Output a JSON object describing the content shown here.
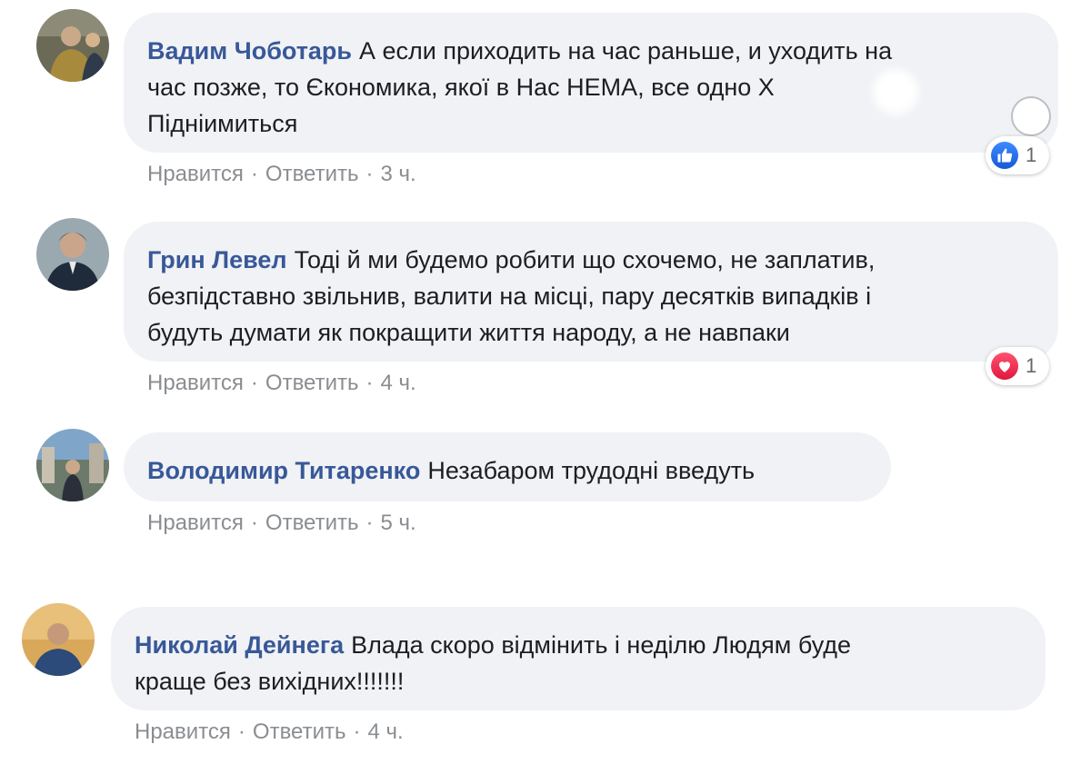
{
  "colors": {
    "bubble_bg": "#f0f2f5",
    "author": "#385898",
    "meta": "#8a8d91",
    "like_blue": "#1877f2",
    "love_red": "#e1173e"
  },
  "comments": [
    {
      "author": "Вадим Чоботарь",
      "text_lines": [
        "А если приходить на час раньше, и уходить на",
        "час позже, то Єкономика, якої в Нас НЕМА, все одно Х",
        "Підніимиться"
      ],
      "like": "Нравится",
      "reply": "Ответить",
      "time": "3 ч.",
      "reaction_icon": "like-icon",
      "reaction_count": "1"
    },
    {
      "author": "Грин Левел",
      "text_lines": [
        "Тоді й ми будемо робити що схочемо, не заплатив,",
        "безпідставно звільнив, валити на місці, пару десятків випадків і",
        "будуть думати як покращити життя народу, а не навпаки"
      ],
      "like": "Нравится",
      "reply": "Ответить",
      "time": "4 ч.",
      "reaction_icon": "love-icon",
      "reaction_count": "1"
    },
    {
      "author": "Володимир Титаренко",
      "text_lines": [
        "Незабаром трудодні введуть"
      ],
      "like": "Нравится",
      "reply": "Ответить",
      "time": "5 ч."
    },
    {
      "author": "Николай Дейнега",
      "text_lines": [
        "Влада скоро відмінить і неділю Людям буде",
        "краще без вихідних!!!!!!!"
      ],
      "like": "Нравится",
      "reply": "Ответить",
      "time": "4 ч."
    }
  ]
}
